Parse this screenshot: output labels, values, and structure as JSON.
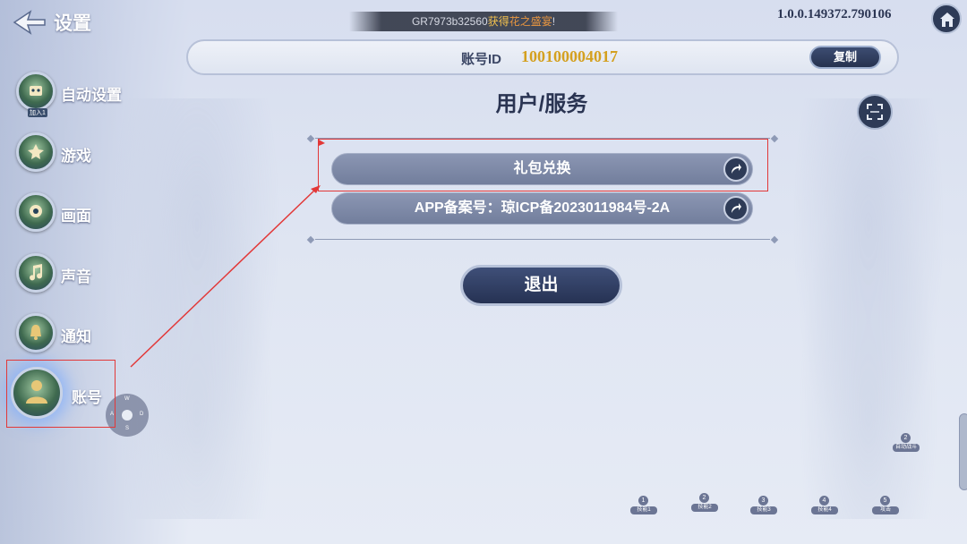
{
  "header": {
    "title": "设置",
    "version": "1.0.0.149372.790106"
  },
  "broadcast": {
    "player": "GR7973b32560",
    "gain": "获得",
    "item": "花之盛宴",
    "end": "!"
  },
  "sidebar": {
    "items": [
      {
        "label": "自动设置",
        "badge": "加入1"
      },
      {
        "label": "游戏"
      },
      {
        "label": "画面"
      },
      {
        "label": "声音"
      },
      {
        "label": "通知"
      },
      {
        "label": "账号"
      }
    ]
  },
  "joystick": {
    "n": "W",
    "w": "A",
    "e": "D",
    "s": "S"
  },
  "account": {
    "label": "账号ID",
    "value": "100100004017",
    "copy_label": "复制"
  },
  "section": {
    "title": "用户/服务"
  },
  "rows": [
    {
      "label": "礼包兑换"
    },
    {
      "label": "APP备案号：琼ICP备2023011984号-2A"
    }
  ],
  "exit_label": "退出",
  "skills": [
    {
      "num": "1",
      "label": "技能1"
    },
    {
      "num": "2",
      "label": "技能2"
    },
    {
      "num": "3",
      "label": "技能3"
    },
    {
      "num": "4",
      "label": "技能4"
    },
    {
      "num": "5",
      "label": "攻击"
    },
    {
      "num": "2",
      "label": "自动战斗"
    }
  ],
  "colors": {
    "accent_gold": "#d4a01f",
    "button_dark": "#2e3b57",
    "annotation_red": "#e23838"
  }
}
